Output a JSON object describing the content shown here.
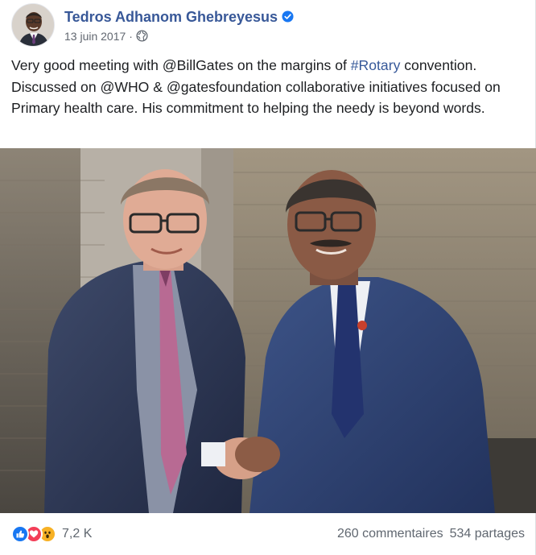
{
  "post": {
    "author": "Tedros Adhanom Ghebreyesus",
    "date": "13 juin 2017",
    "separator": "·",
    "privacy_icon": "globe-icon",
    "verified_icon": "verified-badge-icon",
    "text": {
      "part1": "Very good meeting with ",
      "mention_billgates": "@BillGates",
      "part2": " on the margins of ",
      "hashtag_rotary": "#Rotary",
      "part3": " convention. Discussed on ",
      "mention_who": "@WHO",
      "part4": " & ",
      "mention_gatesfoundation": "@gatesfoundation",
      "part5": " collaborative initiatives focused on Primary health care. His commitment to helping the needy is beyond words."
    },
    "photo_description_icon": "photo-two-men-handshake"
  },
  "footer": {
    "reaction_icons": [
      "like-icon",
      "love-icon",
      "wow-icon"
    ],
    "reaction_count": "7,2 K",
    "comments": "260 commentaires",
    "shares": "534 partages"
  },
  "colors": {
    "author_link": "#385898",
    "hashtag": "#365899",
    "verified": "#1877f2",
    "meta_text": "#616770",
    "like": "#1877f2",
    "love": "#f33e58",
    "wow": "#f7b125"
  }
}
